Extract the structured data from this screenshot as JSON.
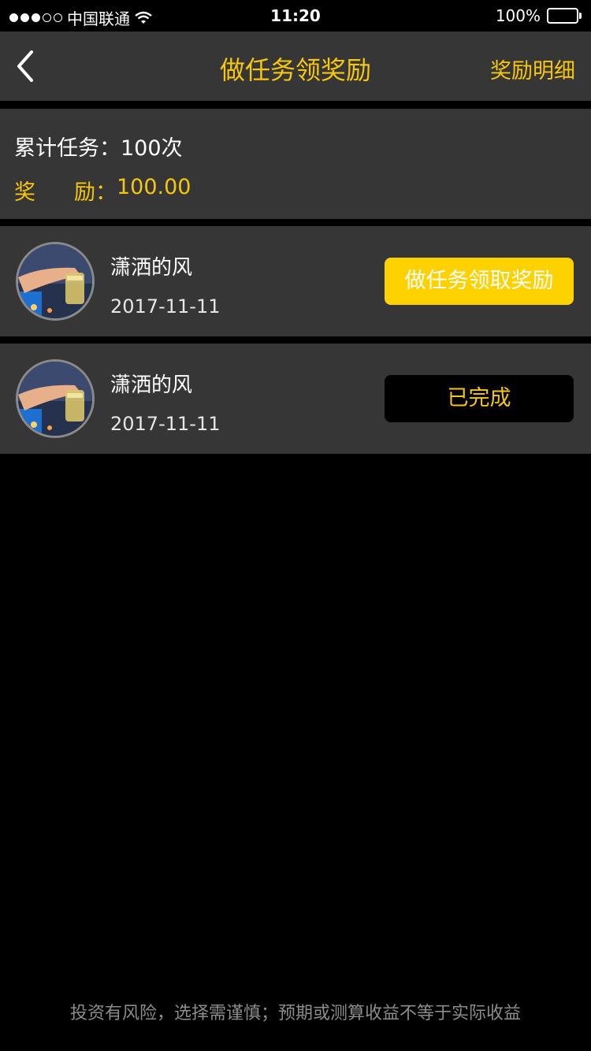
{
  "status_bar": {
    "carrier": "中国联通",
    "time": "11:20",
    "battery": "100%",
    "signal_icon": "signal-dots-icon",
    "wifi_icon": "wifi-icon",
    "battery_icon": "battery-icon"
  },
  "nav": {
    "back_icon": "chevron-left-icon",
    "title": "做任务领奖励",
    "right_link": "奖励明细"
  },
  "summary": {
    "tasks_label": "累计任务：",
    "tasks_value": "100次",
    "reward_label_a": "奖",
    "reward_label_b": "励：",
    "reward_value": "100.00"
  },
  "tasks": [
    {
      "name": "潇洒的风",
      "date": "2017-11-11",
      "button": "做任务领取奖励",
      "status": "active"
    },
    {
      "name": "潇洒的风",
      "date": "2017-11-11",
      "button": "已完成",
      "status": "done"
    }
  ],
  "footer": {
    "note": "投资有风险，选择需谨慎；预期或测算收益不等于实际收益"
  },
  "colors": {
    "accent": "#f7c60e",
    "button_active": "#fed200",
    "panel": "#363636",
    "background": "#000000"
  }
}
